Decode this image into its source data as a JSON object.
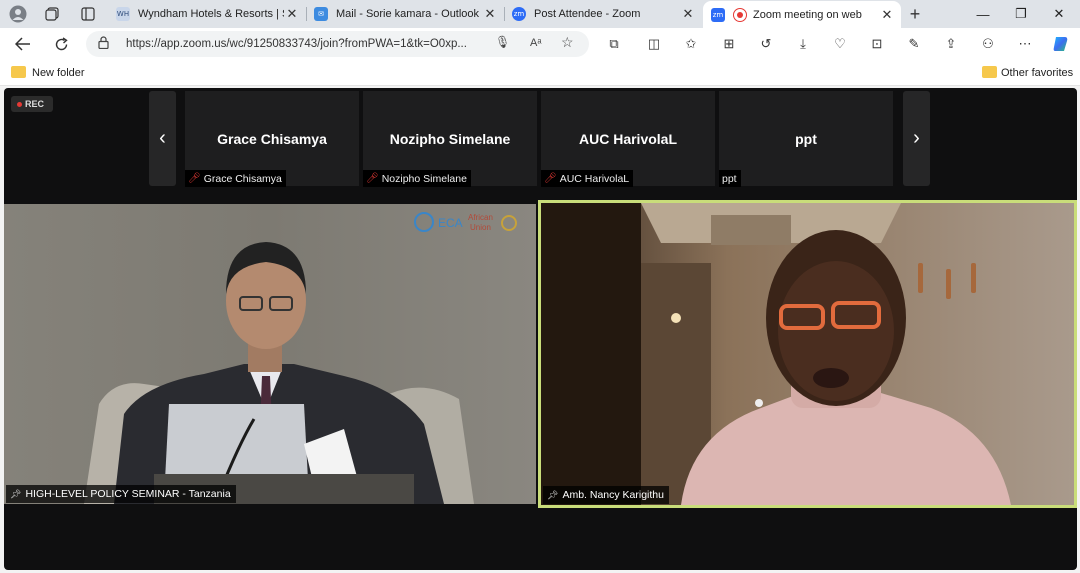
{
  "tabs": [
    {
      "label": "Wyndham Hotels & Resorts | Se",
      "favicon": "WH",
      "color": "#c9d6ea",
      "active": false
    },
    {
      "label": "Mail - Sorie kamara - Outlook",
      "favicon": "mail",
      "color": "#3d8be0",
      "active": false
    },
    {
      "label": "Post Attendee - Zoom",
      "favicon": "zm",
      "color": "#2d6cf6",
      "active": false
    },
    {
      "label": "Zoom meeting on web",
      "favicon": "zm",
      "color": "#2d6cf6",
      "active": true
    }
  ],
  "address_bar": {
    "url": "https://app.zoom.us/wc/91250833743/join?fromPWA=1&tk=O0xp..."
  },
  "favorites": {
    "new_folder": "New folder",
    "other_favorites": "Other favorites"
  },
  "meeting": {
    "rec_label": "REC",
    "thumbnails": [
      {
        "name": "Grace Chisamya",
        "tag": "Grace Chisamya",
        "muted": true
      },
      {
        "name": "Nozipho Simelane",
        "tag": "Nozipho Simelane",
        "muted": true
      },
      {
        "name": "AUC HarivolaL",
        "tag": "AUC HarivolaL",
        "muted": true
      },
      {
        "name": "ppt",
        "tag": "ppt",
        "muted": false
      }
    ],
    "main_videos": [
      {
        "name": "HIGH-LEVEL POLICY SEMINAR - Tanzania",
        "active_speaker": false,
        "logos": [
          "ECA",
          "African Union"
        ]
      },
      {
        "name": "Amb. Nancy Karigithu",
        "active_speaker": true
      }
    ]
  },
  "colors": {
    "speaker_border": "#c9dd7a",
    "meeting_bg": "#0f0f10",
    "muted_icon": "#e53935"
  }
}
